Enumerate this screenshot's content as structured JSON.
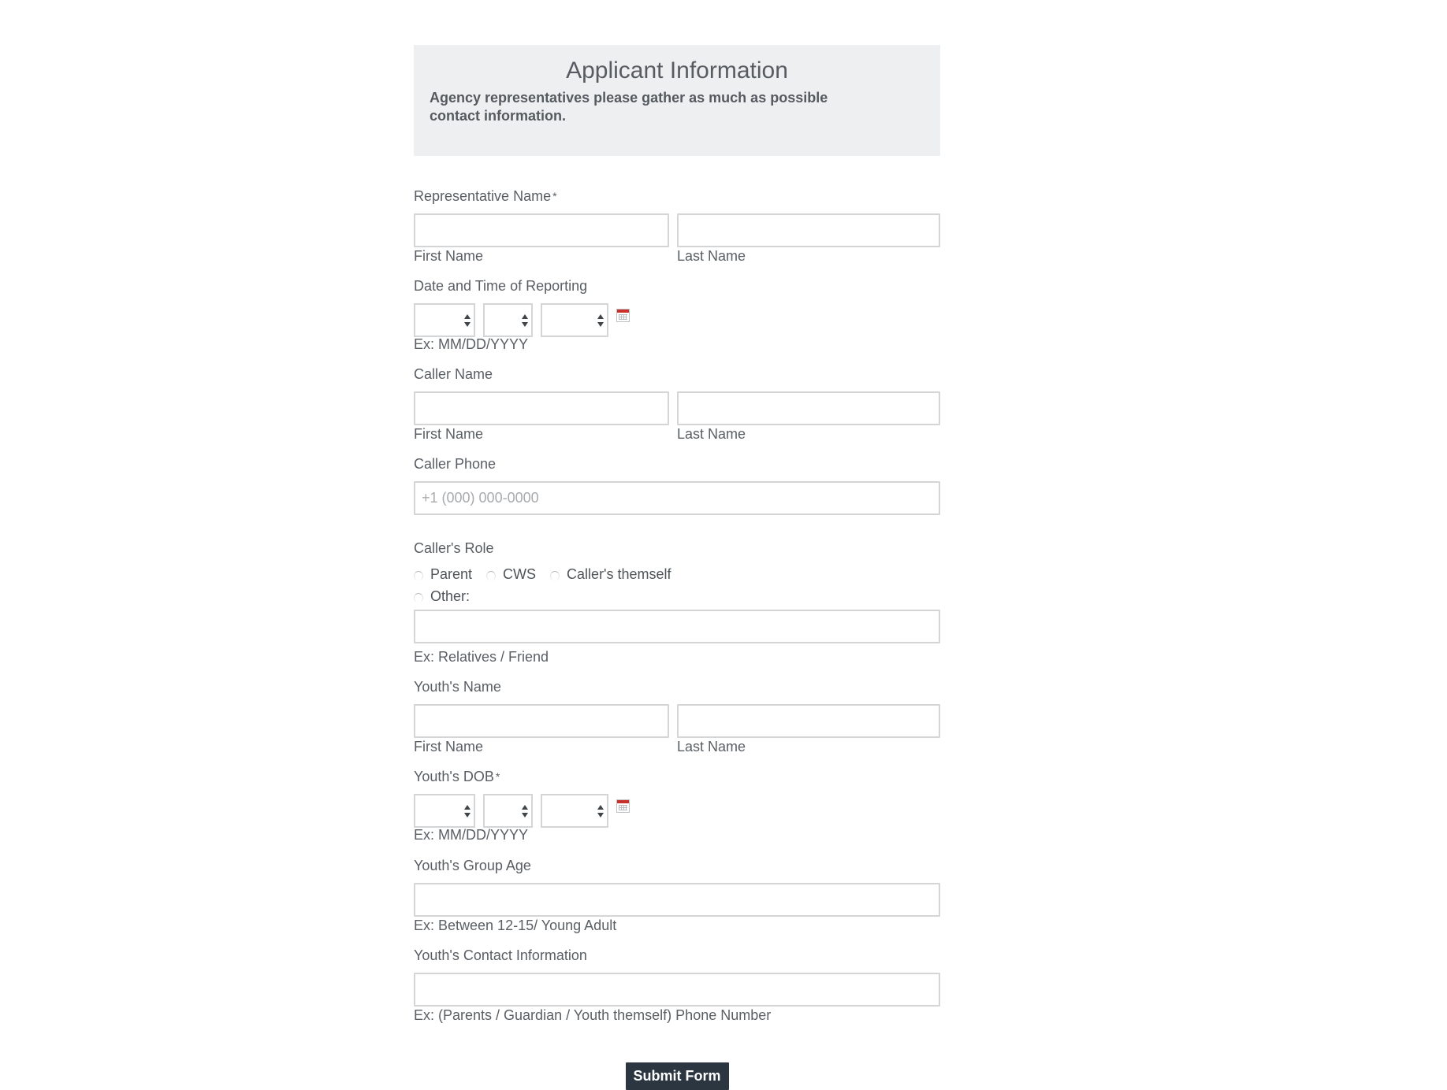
{
  "header": {
    "title": "Applicant Information",
    "subtitle": "Agency representatives please gather as much as possible contact information."
  },
  "fields": {
    "rep_name": {
      "label": "Representative Name",
      "required": "*",
      "first_sub": "First Name",
      "last_sub": "Last Name",
      "first_value": "",
      "last_value": ""
    },
    "date_reporting": {
      "label": "Date and Time of Reporting",
      "hint": "Ex: MM/DD/YYYY",
      "icon": "calendar-icon"
    },
    "caller_name": {
      "label": "Caller Name",
      "first_sub": "First Name",
      "last_sub": "Last Name",
      "first_value": "",
      "last_value": ""
    },
    "caller_phone": {
      "label": "Caller Phone",
      "placeholder": "+1 (000) 000-0000",
      "value": ""
    },
    "caller_role": {
      "label": "Caller's Role",
      "options": [
        "Parent",
        "CWS",
        "Caller's themself",
        "Other:"
      ],
      "other_hint": "Ex: Relatives / Friend",
      "other_value": ""
    },
    "youth_name": {
      "label": "Youth's Name",
      "first_sub": "First Name",
      "last_sub": "Last Name",
      "first_value": "",
      "last_value": ""
    },
    "youth_dob": {
      "label": "Youth's DOB",
      "required": "*",
      "hint": "Ex: MM/DD/YYYY",
      "icon": "calendar-icon"
    },
    "youth_age": {
      "label": "Youth's Group Age",
      "hint": "Ex: Between 12-15/ Young Adult",
      "value": ""
    },
    "youth_contact": {
      "label": "Youth's Contact Information",
      "hint": "Ex: (Parents / Guardian / Youth themself) Phone Number",
      "value": ""
    }
  },
  "submit_label": "Submit Form",
  "colors": {
    "header_bg": "#eeeff0",
    "button_bg": "#2b3640",
    "calendar_red": "#c8312b",
    "input_border": "#d3d5d7"
  }
}
